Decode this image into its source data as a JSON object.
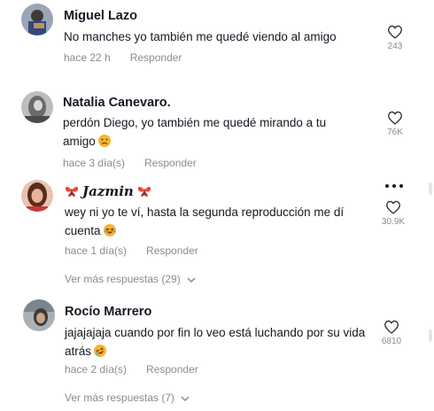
{
  "comments": [
    {
      "username": "Miguel Lazo",
      "text": "No manches yo también me quedé viendo al amigo",
      "time": "hace 22 h",
      "reply": "Responder",
      "likes": "243",
      "avatar_color": "#5b6e8a"
    },
    {
      "username": "Natalia Canevaro.",
      "text": "perdón Diego, yo también me quedé mirando a tu amigo",
      "time": "hace 3 día(s)",
      "reply": "Responder",
      "likes": "76K",
      "avatar_color": "#6d6d6d",
      "emoji": "sad-face-emoji"
    },
    {
      "username": "Jazmin",
      "username_decoration": "butterfly-emoji",
      "text": "wey ni yo te ví, hasta la segunda reproducción me dí cuenta",
      "time": "hace 1 día(s)",
      "reply": "Responder",
      "likes": "30.9K",
      "more_replies": "Ver más respuestas (29)",
      "avatar_color": "#b5634a",
      "emoji": "laughing-face-emoji"
    },
    {
      "username": "Rocío Marrero",
      "text": "jajajajaja cuando por fin lo veo está luchando por su vida atrás",
      "time": "hace 2 día(s)",
      "reply": "Responder",
      "likes": "6810",
      "more_replies": "Ver más respuestas (7)",
      "avatar_color": "#8a949c",
      "emoji": "rofl-face-emoji"
    }
  ],
  "colors": {
    "text": "#161823",
    "muted": "#8a8b91",
    "emoji": "#f5b52e"
  }
}
